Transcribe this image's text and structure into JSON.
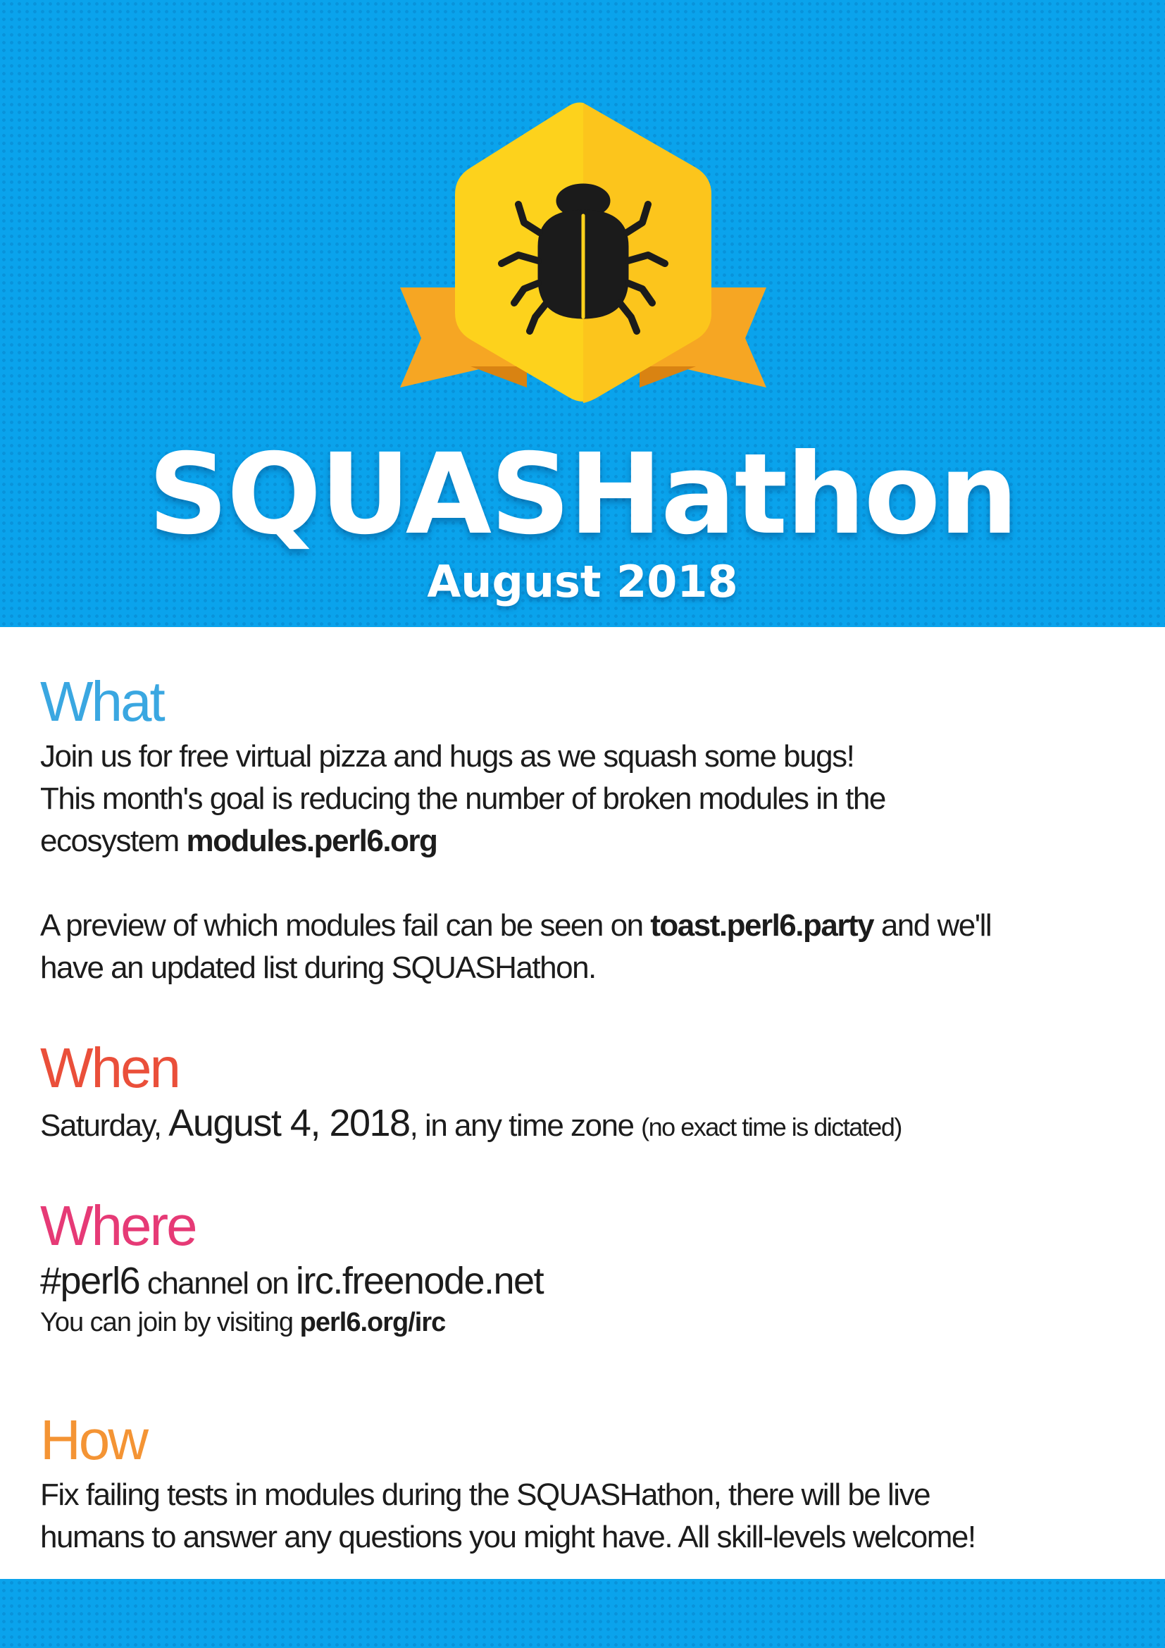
{
  "header": {
    "title": "SQUASHathon",
    "subtitle": "August 2018",
    "badge_icon": "bug-icon",
    "colors": {
      "background": "#0aa3ec",
      "badge_yellow": "#fdd21c",
      "ribbon_orange": "#f6a623"
    }
  },
  "what": {
    "heading": "What",
    "line1": "Join us for free virtual pizza and hugs as we squash some bugs!",
    "line2": "This month's goal is reducing the number of broken modules in the",
    "line3_prefix": "ecosystem ",
    "line3_link": "modules.perl6.org",
    "para2_prefix": "A preview of which modules fail can be seen on ",
    "para2_link": "toast.perl6.party",
    "para2_suffix": " and we'll",
    "para2_line2": "have an updated list during SQUASHathon."
  },
  "when": {
    "heading": "When",
    "day": "Saturday, ",
    "date": "August 4, 2018",
    "timezone": ", in any time zone ",
    "note": "(no exact time is dictated)"
  },
  "where": {
    "heading": "Where",
    "channel": "#perl6",
    "channel_mid": " channel on ",
    "server": "irc.freenode.net",
    "join_prefix": "You can join by visiting ",
    "join_link": "perl6.org/irc"
  },
  "how": {
    "heading": "How",
    "line1": "Fix failing tests in modules during the SQUASHathon, there will be live",
    "line2": "humans to answer any questions you might have. All skill-levels welcome!"
  },
  "colors": {
    "what": "#3aa7e1",
    "when": "#ea4f3a",
    "where": "#e63a76",
    "how": "#f49434"
  }
}
